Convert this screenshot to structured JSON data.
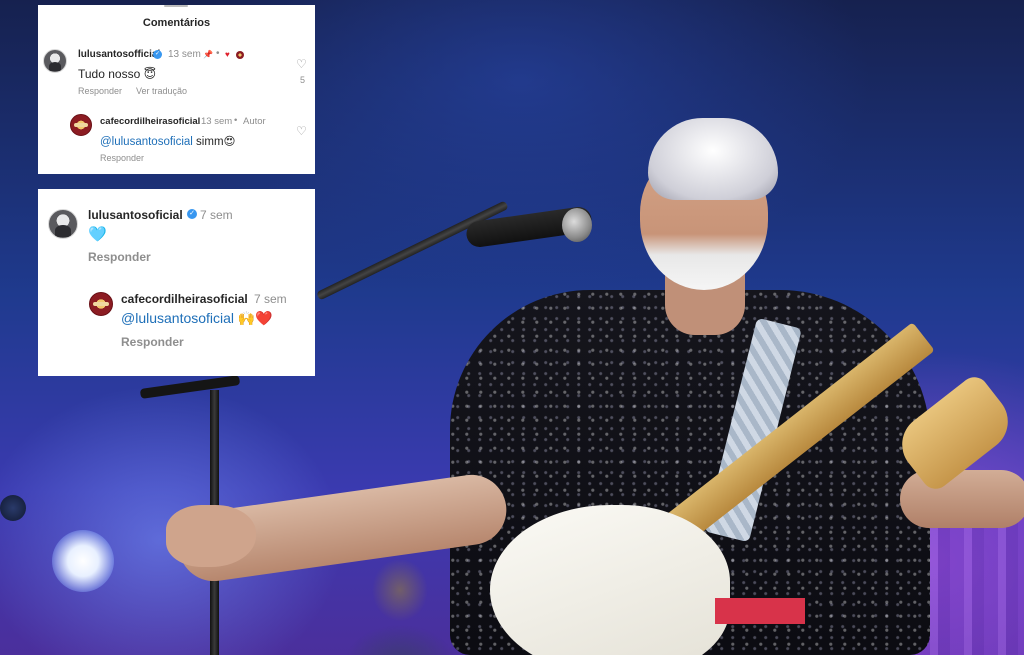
{
  "panel1": {
    "title": "Comentários",
    "comment": {
      "username": "lulusantosofficial",
      "time": "13 sem",
      "text": "Tudo nosso 😇",
      "reply_label": "Responder",
      "translate_label": "Ver tradução",
      "like_count": "5"
    },
    "reply": {
      "username": "cafecordilheirasoficial",
      "time": "13 sem",
      "author_label": "Autor",
      "mention": "@lulusantosoficial",
      "text": " simm😍",
      "reply_label": "Responder"
    }
  },
  "panel2": {
    "comment": {
      "username": "lulusantosoficial",
      "time": "7 sem",
      "text": "🩵",
      "reply_label": "Responder"
    },
    "reply": {
      "username": "cafecordilheirasoficial",
      "time": "7 sem",
      "mention": "@lulusantosoficial",
      "text": " 🙌❤️",
      "reply_label": "Responder"
    }
  },
  "colors": {
    "mention": "#1e6fb8",
    "verified": "#3897f0",
    "secondary_text": "#8e8e8e"
  },
  "icons": [
    "heart-icon",
    "verified-badge-icon",
    "pin-icon"
  ]
}
